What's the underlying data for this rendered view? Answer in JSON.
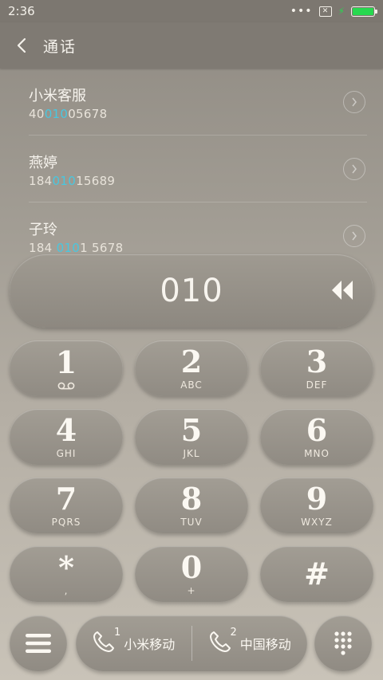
{
  "status": {
    "time": "2:36",
    "more": "•••"
  },
  "header": {
    "title": "通话"
  },
  "contacts": [
    {
      "name": "小米客服",
      "num_pre": "40",
      "num_hl": "010",
      "num_post": "05678"
    },
    {
      "name": "燕婷",
      "num_pre": "184",
      "num_hl": "010",
      "num_post": "15689"
    },
    {
      "name": "子玲",
      "num_pre": "184 ",
      "num_hl": "010",
      "num_post": "1 5678"
    }
  ],
  "display": {
    "digits": "010"
  },
  "keys": [
    {
      "digit": "1",
      "letters": ""
    },
    {
      "digit": "2",
      "letters": "ABC"
    },
    {
      "digit": "3",
      "letters": "DEF"
    },
    {
      "digit": "4",
      "letters": "GHI"
    },
    {
      "digit": "5",
      "letters": "JKL"
    },
    {
      "digit": "6",
      "letters": "MNO"
    },
    {
      "digit": "7",
      "letters": "PQRS"
    },
    {
      "digit": "8",
      "letters": "TUV"
    },
    {
      "digit": "9",
      "letters": "WXYZ"
    },
    {
      "digit": "*",
      "letters": ","
    },
    {
      "digit": "0",
      "letters": "+"
    },
    {
      "digit": "#",
      "letters": ""
    }
  ],
  "sims": [
    {
      "slot": "1",
      "label": "小米移动"
    },
    {
      "slot": "2",
      "label": "中国移动"
    }
  ],
  "colors": {
    "highlight": "#48c7e0",
    "battery": "#27d84f"
  }
}
